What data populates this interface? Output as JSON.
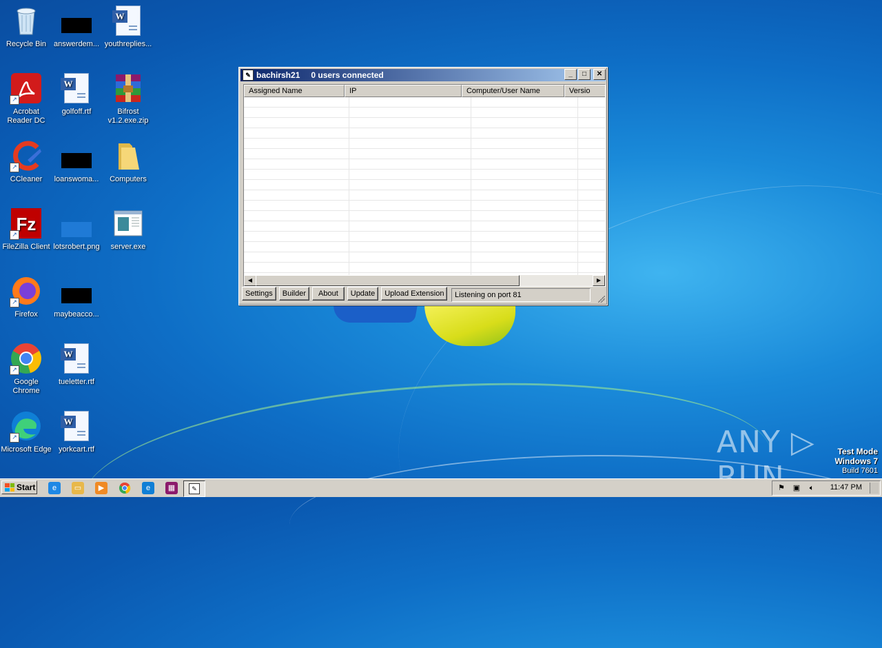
{
  "desktop": {
    "icons": [
      {
        "label": "Recycle Bin"
      },
      {
        "label": "answerdem..."
      },
      {
        "label": "youthreplies..."
      },
      {
        "label": "Acrobat Reader DC"
      },
      {
        "label": "golfoff.rtf"
      },
      {
        "label": "Bifrost v1.2.exe.zip"
      },
      {
        "label": "CCleaner"
      },
      {
        "label": "loanswoma..."
      },
      {
        "label": "Computers"
      },
      {
        "label": "FileZilla Client"
      },
      {
        "label": "lotsrobert.png"
      },
      {
        "label": "server.exe"
      },
      {
        "label": "Firefox"
      },
      {
        "label": "maybeacco..."
      },
      {
        "label": "Google Chrome"
      },
      {
        "label": "tueletter.rtf"
      },
      {
        "label": "Microsoft Edge"
      },
      {
        "label": "yorkcart.rtf"
      }
    ]
  },
  "window": {
    "title": "bachirsh21",
    "subtitle": "0 users connected",
    "controls": {
      "minimize": "_",
      "maximize": "□",
      "close": "✕"
    },
    "columns": [
      "Assigned Name",
      "IP",
      "Computer/User Name",
      "Versio"
    ],
    "buttons": {
      "settings": "Settings",
      "builder": "Builder",
      "about": "About",
      "update": "Update",
      "upload_extension": "Upload Extension"
    },
    "status": "Listening on port 81"
  },
  "watermark": {
    "brand": "ANY ▷ RUN",
    "mode": "Test Mode",
    "os": "Windows 7",
    "build": "Build 7601"
  },
  "taskbar": {
    "start_label": "Start",
    "clock": "11:47 PM"
  }
}
